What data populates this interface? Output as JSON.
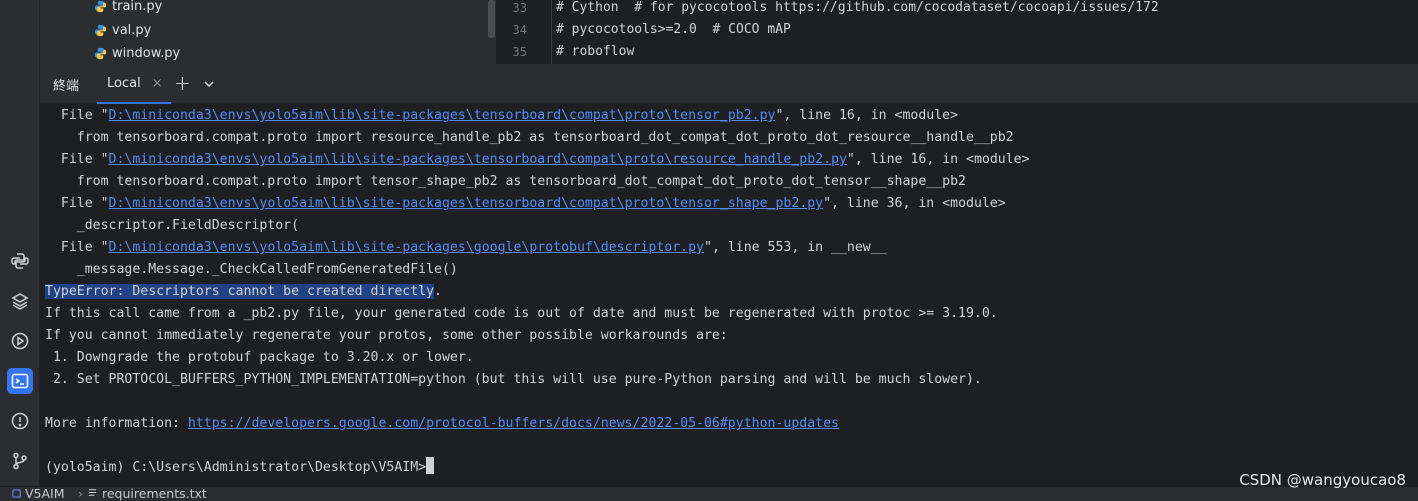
{
  "project_tree": {
    "files": [
      "train.py",
      "val.py",
      "window.py"
    ]
  },
  "editor": {
    "lines": [
      {
        "num": "33",
        "text": "# Cython  # for pycocotools https://github.com/cocodataset/cocoapi/issues/172"
      },
      {
        "num": "34",
        "text": "# pycocotools>=2.0  # COCO mAP"
      },
      {
        "num": "35",
        "text": "# roboflow"
      }
    ]
  },
  "terminal_toolbar": {
    "title": "終端",
    "tab_label": "Local",
    "close_glyph": "×",
    "add_glyph": "+"
  },
  "terminal": {
    "frames": [
      {
        "prefix": "  File \"",
        "path": "D:\\miniconda3\\envs\\yolo5aim\\lib\\site-packages\\tensorboard\\compat\\proto\\tensor_pb2.py",
        "suffix": "\", line 16, in <module>",
        "code": "    from tensorboard.compat.proto import resource_handle_pb2 as tensorboard_dot_compat_dot_proto_dot_resource__handle__pb2"
      },
      {
        "prefix": "  File \"",
        "path": "D:\\miniconda3\\envs\\yolo5aim\\lib\\site-packages\\tensorboard\\compat\\proto\\resource_handle_pb2.py",
        "suffix": "\", line 16, in <module>",
        "code": "    from tensorboard.compat.proto import tensor_shape_pb2 as tensorboard_dot_compat_dot_proto_dot_tensor__shape__pb2"
      },
      {
        "prefix": "  File \"",
        "path": "D:\\miniconda3\\envs\\yolo5aim\\lib\\site-packages\\tensorboard\\compat\\proto\\tensor_shape_pb2.py",
        "suffix": "\", line 36, in <module>",
        "code": "    _descriptor.FieldDescriptor("
      },
      {
        "prefix": "  File \"",
        "path": "D:\\miniconda3\\envs\\yolo5aim\\lib\\site-packages\\google\\protobuf\\descriptor.py",
        "suffix": "\", line 553, in __new__",
        "code": "    _message.Message._CheckCalledFromGeneratedFile()"
      }
    ],
    "error_selected": "TypeError: Descriptors cannot be created directly",
    "error_tail": ".",
    "messages": [
      "If this call came from a _pb2.py file, your generated code is out of date and must be regenerated with protoc >= 3.19.0.",
      "If you cannot immediately regenerate your protos, some other possible workarounds are:",
      " 1. Downgrade the protobuf package to 3.20.x or lower.",
      " 2. Set PROTOCOL_BUFFERS_PYTHON_IMPLEMENTATION=python (but this will use pure-Python parsing and will be much slower)."
    ],
    "more_info_label": "More information: ",
    "more_info_url": "https://developers.google.com/protocol-buffers/docs/news/2022-05-06#python-updates",
    "prompt": "(yolo5aim) C:\\Users\\Administrator\\Desktop\\V5AIM>"
  },
  "status_bar": {
    "project": "V5AIM",
    "file": "requirements.txt"
  },
  "watermark": "CSDN @wangyoucao8",
  "colors": {
    "accent": "#3574f0",
    "link": "#548af7",
    "selection": "#214283",
    "background": "#1e1f22",
    "panel": "#2b2d30"
  },
  "icons": [
    "python-console-icon",
    "layers-icon",
    "run-services-icon",
    "terminal-icon",
    "problems-icon",
    "git-icon"
  ]
}
